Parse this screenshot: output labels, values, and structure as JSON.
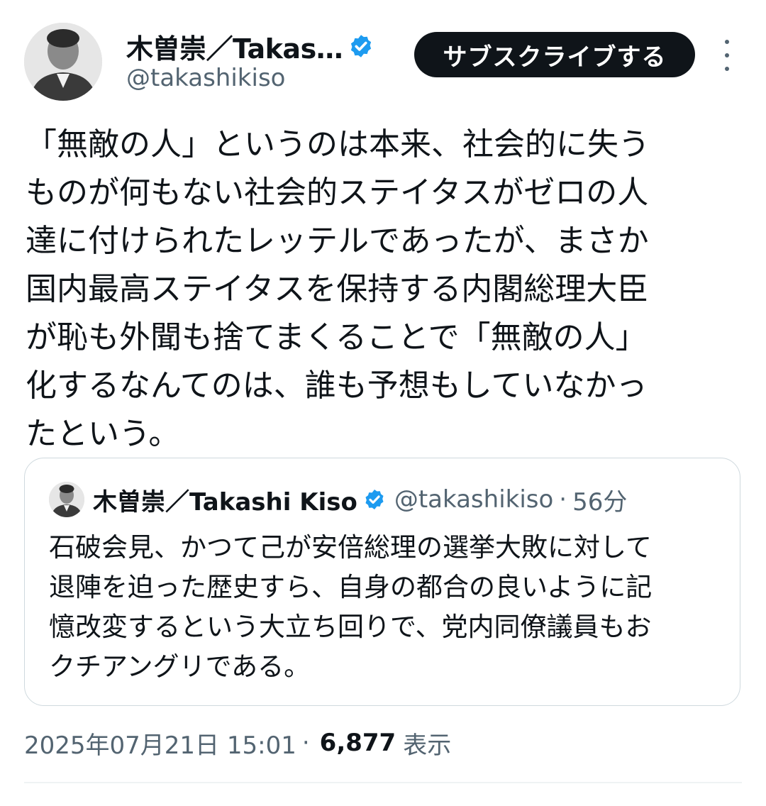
{
  "author": {
    "display_name": "木曽崇／Takas…",
    "handle": "@takashikiso",
    "verified_icon": "verified-badge-icon"
  },
  "subscribe_label": "サブスクライブする",
  "tweet_text": "「無敵の人」というのは本来、社会的に失う\nものが何もない社会的ステイタスがゼロの人\n達に付けられたレッテルであったが、まさか\n国内最高ステイタスを保持する内閣総理大臣\nが恥も外聞も捨てまくることで「無敵の人」\n化するなんてのは、誰も予想もしていなかっ\nたという。",
  "quote": {
    "display_name": "木曽崇／Takashi Kiso",
    "handle": "@takashikiso",
    "separator": "·",
    "time": "56分",
    "text": "石破会見、かつて己が安倍総理の選挙大敗に対して\n退陣を迫った歴史すら、自身の都合の良いように記\n憶改変するという大立ち回りで、党内同僚議員もお\nクチアングリである。"
  },
  "meta": {
    "timestamp": "2025年07月21日 15:01",
    "separator": "·",
    "views_count": "6,877",
    "views_label": "表示"
  },
  "colors": {
    "text": "#0f1419",
    "muted": "#536471",
    "verified": "#1d9bf0",
    "button_bg": "#0f1419",
    "border": "#cfd9de"
  }
}
